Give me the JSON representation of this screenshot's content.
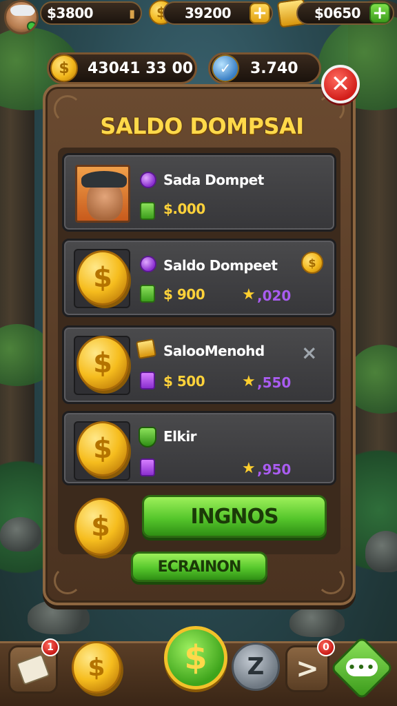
{
  "top_bar": {
    "currency_1": "$3800",
    "currency_2": "39200",
    "currency_3": "$0650"
  },
  "second_bar": {
    "coins": "43041 33 00",
    "tokens": "3.740"
  },
  "panel": {
    "title": "SALDO DOMPSAI",
    "rows": [
      {
        "name": "Sada Dompet",
        "amount": "$.000",
        "stars": ""
      },
      {
        "name": "Saldo Dompeet",
        "amount": "$ 900",
        "stars": ",020"
      },
      {
        "name": "SalooMenohd",
        "amount": "$ 500",
        "stars": ",550"
      },
      {
        "name": "Elkir",
        "amount": "",
        "stars": ",950"
      }
    ],
    "primary_button": "INGNOS",
    "secondary_button": "ECRAINON"
  },
  "bottom_nav": {
    "badge_1": "1",
    "badge_2": "0",
    "center_symbol": "$",
    "grey_symbol": "Z",
    "arrow_symbol": ">",
    "chat_symbol": "•••"
  },
  "colors": {
    "gold": "#ffd94a",
    "green_button": "#56c72c",
    "panel_brown": "#4a3220",
    "close_red": "#d21e1a"
  }
}
